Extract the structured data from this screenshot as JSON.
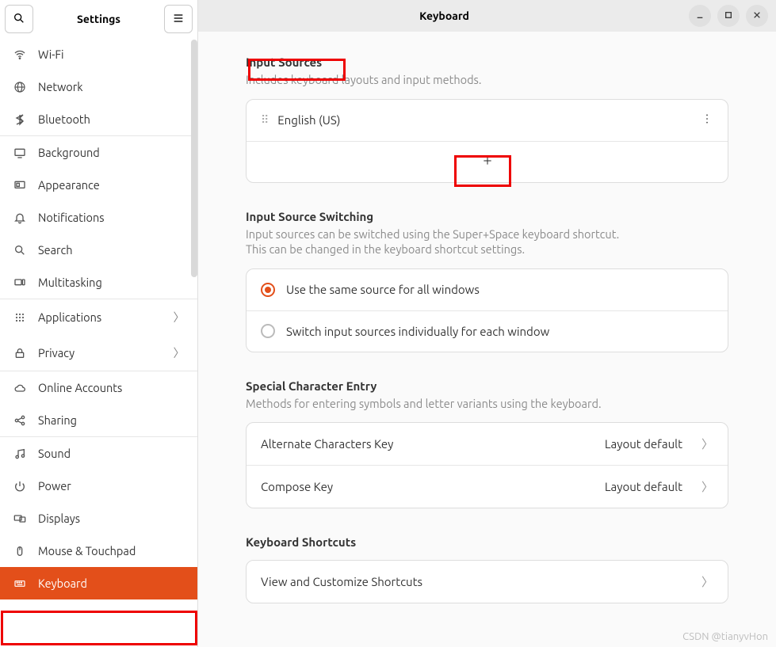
{
  "sidebar": {
    "title": "Settings",
    "items": [
      {
        "label": "Wi-Fi",
        "icon": "wifi"
      },
      {
        "label": "Network",
        "icon": "globe"
      },
      {
        "label": "Bluetooth",
        "icon": "bluetooth"
      },
      {
        "label": "Background",
        "icon": "monitor"
      },
      {
        "label": "Appearance",
        "icon": "appearance"
      },
      {
        "label": "Notifications",
        "icon": "bell"
      },
      {
        "label": "Search",
        "icon": "search"
      },
      {
        "label": "Multitasking",
        "icon": "multitask"
      },
      {
        "label": "Applications",
        "icon": "grid",
        "chev": true
      },
      {
        "label": "Privacy",
        "icon": "lock",
        "chev": true
      },
      {
        "label": "Online Accounts",
        "icon": "cloud"
      },
      {
        "label": "Sharing",
        "icon": "share"
      },
      {
        "label": "Sound",
        "icon": "music"
      },
      {
        "label": "Power",
        "icon": "power"
      },
      {
        "label": "Displays",
        "icon": "displays"
      },
      {
        "label": "Mouse & Touchpad",
        "icon": "mouse"
      },
      {
        "label": "Keyboard",
        "icon": "keyboard",
        "active": true
      }
    ]
  },
  "header": {
    "title": "Keyboard"
  },
  "sections": {
    "input_sources": {
      "title": "Input Sources",
      "desc": "Includes keyboard layouts and input methods.",
      "items": [
        {
          "label": "English (US)"
        }
      ]
    },
    "switching": {
      "title": "Input Source Switching",
      "desc": "Input sources can be switched using the Super+Space keyboard shortcut.\nThis can be changed in the keyboard shortcut settings.",
      "radios": [
        {
          "label": "Use the same source for all windows",
          "checked": true
        },
        {
          "label": "Switch input sources individually for each window",
          "checked": false
        }
      ]
    },
    "special": {
      "title": "Special Character Entry",
      "desc": "Methods for entering symbols and letter variants using the keyboard.",
      "rows": [
        {
          "label": "Alternate Characters Key",
          "value": "Layout default"
        },
        {
          "label": "Compose Key",
          "value": "Layout default"
        }
      ]
    },
    "shortcuts": {
      "title": "Keyboard Shortcuts",
      "row": {
        "label": "View and Customize Shortcuts"
      }
    }
  },
  "watermark": "CSDN @tianyvHon"
}
